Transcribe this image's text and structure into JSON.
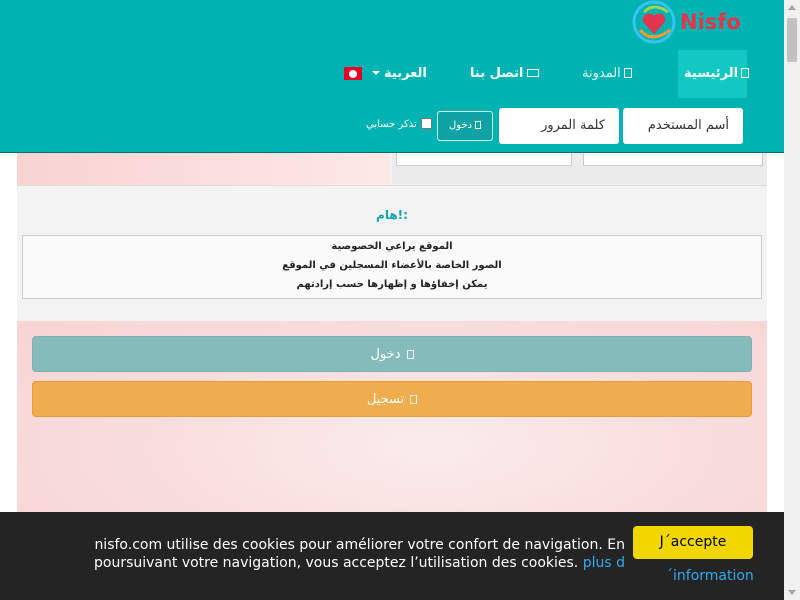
{
  "brand": {
    "name": "Nisfo",
    "logo_icon": "heart-swirl-logo-icon",
    "accent": "#00b3b3",
    "logo_color": "#e2364f"
  },
  "nav": {
    "home": "الرئيسية",
    "blog": "المدونة",
    "contact": "اتصل بنا",
    "language": "العربية",
    "flag_icon": "tunisia-flag-icon"
  },
  "login_form": {
    "username_placeholder": "أسم المستخدم",
    "password_placeholder": "كلمة المرور",
    "login_label": "دخول",
    "remember_label": "تذكر حسابي"
  },
  "notice": {
    "title": "هام!:",
    "lines": [
      "الموقع يراعي الخصوصية",
      "الصور الخاصة بالأعضاء المسجلين في الموقع",
      "يمكن إخفاؤها و إظهارها حسب إرادتهم"
    ]
  },
  "actions": {
    "login_label": "دخول",
    "register_label": "تسجيل",
    "login_color": "#86bbbb",
    "register_color": "#f0ad4e"
  },
  "cookie": {
    "text": "nisfo.com utilise des cookies pour améliorer votre confort de navigation. En poursuivant votre navigation, vous acceptez l’utilisation des cookies.",
    "link_part1": "plus d",
    "link_part2": "´information",
    "accept_label": "J´accepte",
    "accept_color": "#f1d600"
  }
}
